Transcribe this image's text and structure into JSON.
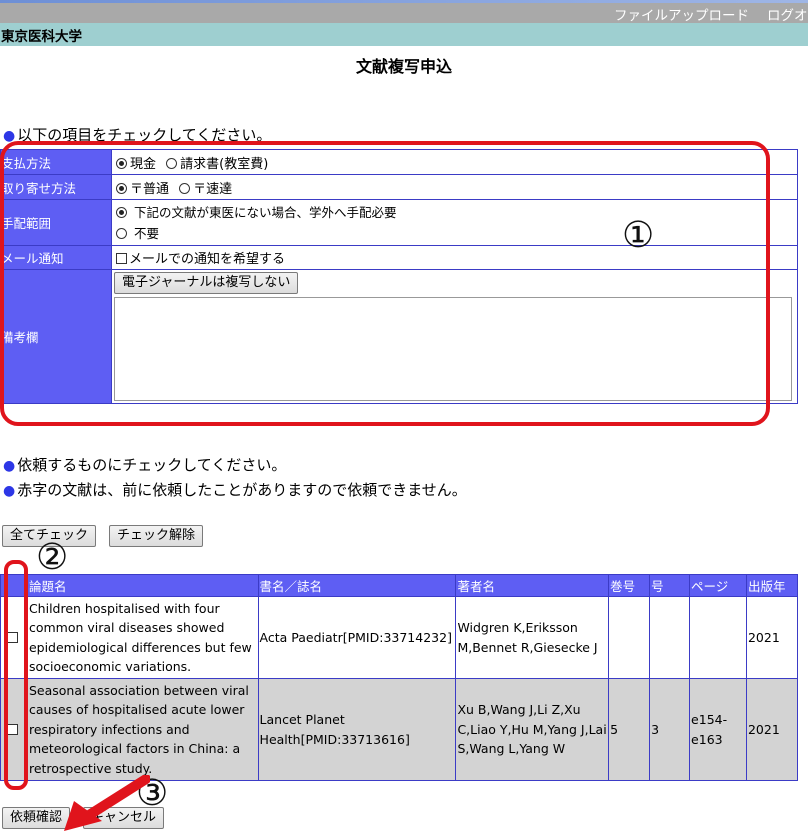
{
  "header": {
    "file_upload": "ファイルアップロード",
    "logout": "ログオ",
    "university": "東京医科大学"
  },
  "page_title": "文献複写申込",
  "notice_check_items": "以下の項目をチェックしてください。",
  "options": {
    "payment": {
      "label": "支払方法",
      "choices": [
        {
          "label": "現金",
          "selected": true
        },
        {
          "label": "請求書(教室費)",
          "selected": false
        }
      ]
    },
    "delivery": {
      "label": "取り寄せ方法",
      "choices": [
        {
          "label": "〒普通",
          "selected": true
        },
        {
          "label": "〒速達",
          "selected": false
        }
      ]
    },
    "arrangement": {
      "label": "手配範囲",
      "choices": [
        {
          "label": "下記の文献が東医にない場合、学外へ手配必要",
          "selected": true
        },
        {
          "label": "不要",
          "selected": false
        }
      ]
    },
    "mail": {
      "label": "メール通知",
      "checkbox_label": "メールでの通知を希望する",
      "checked": false
    },
    "remarks": {
      "label": "備考欄",
      "button_label": "電子ジャーナルは複写しない",
      "value": ""
    }
  },
  "notice_request": "依頼するものにチェックしてください。",
  "notice_red": "赤字の文献は、前に依頼したことがありますので依頼できません。",
  "buttons": {
    "check_all": "全てチェック",
    "uncheck": "チェック解除",
    "confirm": "依頼確認",
    "cancel": "キャンセル"
  },
  "table": {
    "headers": [
      "論題名",
      "書名／誌名",
      "著者名",
      "巻号",
      "号",
      "ページ",
      "出版年"
    ],
    "rows": [
      {
        "title": "Children hospitalised with four common viral diseases showed epidemiological differences but few socioeconomic variations.",
        "journal": "Acta Paediatr[PMID:33714232]",
        "authors": "Widgren K,Eriksson M,Bennet R,Giesecke J",
        "volume": "",
        "issue": "",
        "pages": "",
        "year": "2021"
      },
      {
        "title": "Seasonal association between viral causes of hospitalised acute lower respiratory infections and meteorological factors in China: a retrospective study.",
        "journal": "Lancet Planet Health[PMID:33713616]",
        "authors": "Xu B,Wang J,Li Z,Xu C,Liao Y,Hu M,Yang J,Lai S,Wang L,Yang W",
        "volume": "5",
        "issue": "3",
        "pages": "e154-e163",
        "year": "2021"
      }
    ]
  },
  "annotations": {
    "n1": "①",
    "n2": "②",
    "n3": "③",
    "color": "#e0141c"
  }
}
